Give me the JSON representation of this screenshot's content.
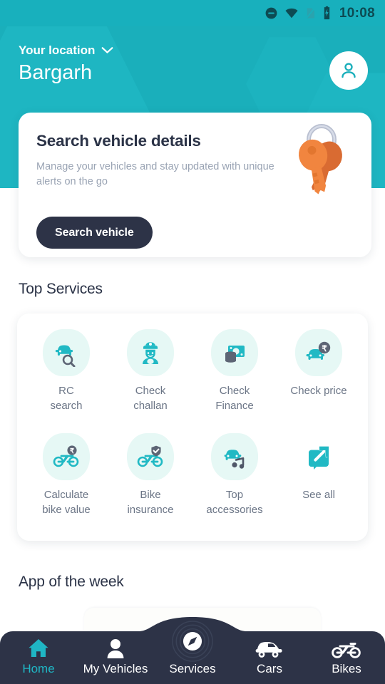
{
  "statusbar": {
    "time": "10:08",
    "icons": [
      "do-not-disturb-icon",
      "wifi-icon",
      "sim-card-off-icon",
      "battery-charging-icon"
    ]
  },
  "header": {
    "location_label": "Your location",
    "location_dropdown_icon": "chevron-down-icon",
    "city": "Bargarh",
    "avatar_icon": "person-icon",
    "background_color": "#1aafbb"
  },
  "search_card": {
    "title": "Search vehicle details",
    "subtitle": "Manage your vehicles and stay updated with unique alerts on the go",
    "button_label": "Search vehicle",
    "button_color": "#2d3347",
    "illustration_icon": "car-keys-icon"
  },
  "top_services": {
    "heading": "Top Services",
    "tile_color": "#e6f8f5",
    "accent_color": "#21b9c4",
    "items": [
      {
        "label": "RC\nsearch",
        "icon": "car-search-icon"
      },
      {
        "label": "Check\nchallan",
        "icon": "police-officer-icon"
      },
      {
        "label": "Check\nFinance",
        "icon": "money-coins-icon"
      },
      {
        "label": "Check price",
        "icon": "car-rupee-icon"
      },
      {
        "label": "Calculate\nbike value",
        "icon": "bike-rupee-icon"
      },
      {
        "label": "Bike\ninsurance",
        "icon": "bike-shield-icon"
      },
      {
        "label": "Top\naccessories",
        "icon": "car-music-icon"
      },
      {
        "label": "See all",
        "icon": "external-link-icon"
      }
    ]
  },
  "app_of_week": {
    "heading": "App of the week"
  },
  "bottom_nav": {
    "background_color": "#2d3347",
    "active_color": "#1fb6c4",
    "items": [
      {
        "label": "Home",
        "icon": "home-icon",
        "active": true
      },
      {
        "label": "My Vehicles",
        "icon": "person-icon",
        "active": false
      },
      {
        "label": "Services",
        "icon": "compass-icon",
        "active": false
      },
      {
        "label": "Cars",
        "icon": "car-icon",
        "active": false
      },
      {
        "label": "Bikes",
        "icon": "motorbike-icon",
        "active": false
      }
    ]
  }
}
